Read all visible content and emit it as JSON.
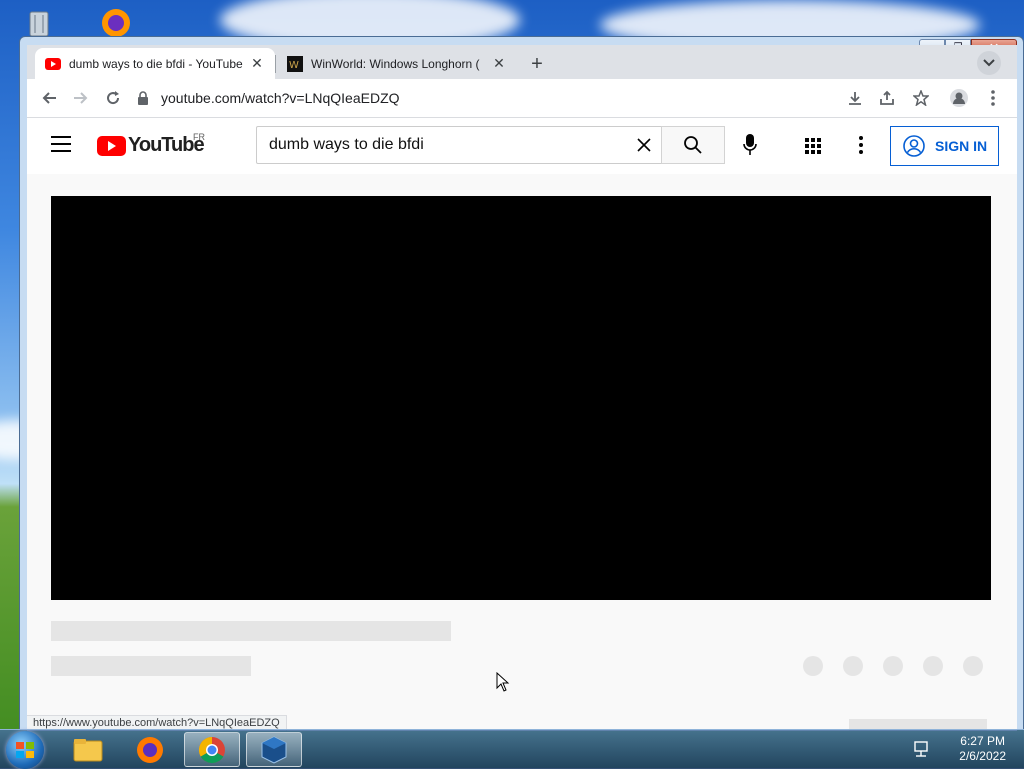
{
  "browser": {
    "tabs": [
      {
        "title": "dumb ways to die bfdi - YouTube",
        "active": true,
        "favicon": "youtube-icon"
      },
      {
        "title": "WinWorld: Windows Longhorn (",
        "active": false,
        "favicon": "winworld-icon"
      }
    ],
    "address": "youtube.com/watch?v=LNqQIeaEDZQ",
    "status_url": "https://www.youtube.com/watch?v=LNqQIeaEDZQ"
  },
  "youtube": {
    "logo_text": "YouTube",
    "country_code": "FR",
    "search_query": "dumb ways to die bfdi",
    "sign_in": "SIGN IN"
  },
  "taskbar": {
    "apps": [
      "file-explorer-icon",
      "firefox-icon",
      "chrome-icon",
      "virtualbox-icon"
    ],
    "time": "6:27 PM",
    "date": "2/6/2022"
  },
  "colors": {
    "youtube_red": "#ff0000",
    "signin_blue": "#065fd4",
    "loading_bar": "#d93025"
  }
}
